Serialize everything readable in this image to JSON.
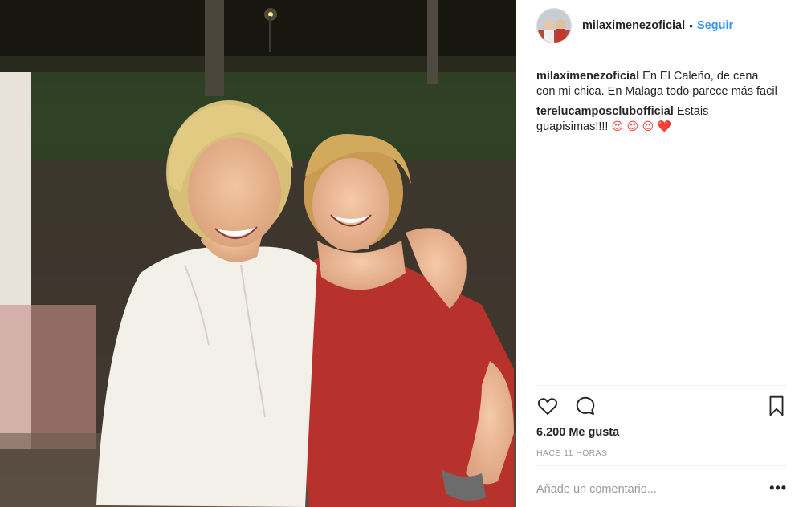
{
  "post": {
    "image_alt": "Two women smiling together outdoors at night",
    "author": "milaximenezoficial",
    "follow_label": "Seguir",
    "separator": "•",
    "caption": {
      "user": "milaximenezoficial",
      "text": "En El Caleño, de cena con mi chica. En Malaga todo parece más facil"
    },
    "comments": [
      {
        "user": "terelucamposclubofficial",
        "text": "Estais guapisimas!!!!",
        "emojis": "😍 😍 😍 ❤️"
      }
    ],
    "likes": "6.200 Me gusta",
    "timestamp": "HACE 11 HORAS",
    "add_comment_placeholder": "Añade un comentario...",
    "more_label": "•••"
  },
  "icons": {
    "like": "heart-icon",
    "comment": "comment-bubble-icon",
    "save": "bookmark-icon",
    "more": "more-options-icon"
  },
  "colors": {
    "link_blue": "#3897f0",
    "text": "#262626",
    "muted": "#999999",
    "divider": "#efefef"
  }
}
